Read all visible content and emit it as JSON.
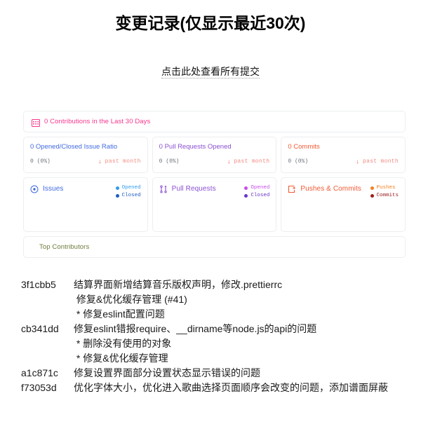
{
  "header": {
    "title": "变更记录(仅显示最近30次)",
    "all_commits_link": "点击此处查看所有提交"
  },
  "stats": {
    "contributions": {
      "icon": "calendar-grid-icon",
      "label": "0 Contributions in the Last 30 Days",
      "color": "#f6368c"
    },
    "ratio_cards": [
      {
        "title": "0 Opened/Closed Issue Ratio",
        "value": "0 (0%)",
        "trend_arrow": "↓",
        "trend_label": "past month",
        "color": "#4169e1"
      },
      {
        "title": "0 Pull Requests Opened",
        "value": "0 (0%)",
        "trend_arrow": "↓",
        "trend_label": "past month",
        "color": "#8a4fd3"
      },
      {
        "title": "0 Commits",
        "value": "0 (0%)",
        "trend_arrow": "↓",
        "trend_label": "past month",
        "color": "#f05a33"
      }
    ],
    "graph_cards": [
      {
        "icon": "issue-opened-icon",
        "title": "Issues",
        "color": "#4169e1",
        "legend": [
          {
            "label": "Opened",
            "color": "#2d9cf0"
          },
          {
            "label": "Closed",
            "color": "#1f5cc4"
          }
        ]
      },
      {
        "icon": "pull-request-icon",
        "title": "Pull Requests",
        "color": "#8a4fd3",
        "legend": [
          {
            "label": "Opened",
            "color": "#c84df0"
          },
          {
            "label": "Closed",
            "color": "#6b35c9"
          }
        ]
      },
      {
        "icon": "push-commit-icon",
        "title": "Pushes & Commits",
        "color": "#f05a33",
        "legend": [
          {
            "label": "Pushes",
            "color": "#f7801e"
          },
          {
            "label": "Commits",
            "color": "#9c2020"
          }
        ]
      }
    ],
    "top_contributors": {
      "label": "Top Contributors",
      "color": "#6b7a3a"
    }
  },
  "commits": [
    {
      "hash": "3f1cbb5",
      "message": "结算界面新增结算音乐版权声明，修改.prettierrc"
    },
    {
      "hash": "",
      "message": " 修复&优化缓存管理 (#41)"
    },
    {
      "hash": "",
      "message": ""
    },
    {
      "hash": "",
      "message": " * 修复eslint配置问题"
    },
    {
      "hash": "cb341dd",
      "message": "修复eslint错报require、__dirname等node.js的api的问题"
    },
    {
      "hash": "",
      "message": ""
    },
    {
      "hash": "",
      "message": " * 删除没有使用的对象"
    },
    {
      "hash": "",
      "message": ""
    },
    {
      "hash": "",
      "message": " * 修复&优化缓存管理"
    },
    {
      "hash": "a1c871c",
      "message": "修复设置界面部分设置状态显示错误的问题"
    },
    {
      "hash": "f73053d",
      "message": "优化字体大小，优化进入歌曲选择页面顺序会改变的问题，添加谱面屏蔽"
    }
  ]
}
